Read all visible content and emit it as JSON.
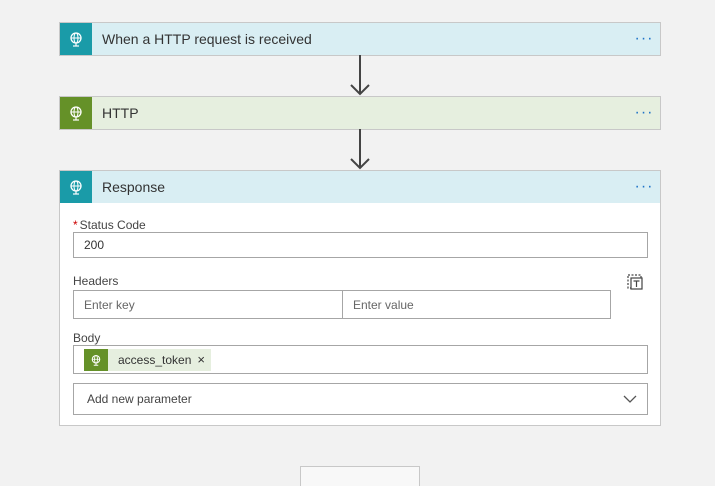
{
  "steps": {
    "trigger": {
      "title": "When a HTTP request is received",
      "more": "···",
      "icon": "globe-icon",
      "accent": "#1a9ba8"
    },
    "http": {
      "title": "HTTP",
      "more": "···",
      "icon": "globe-icon",
      "accent": "#659128"
    },
    "response": {
      "title": "Response",
      "more": "···",
      "icon": "globe-icon",
      "accent": "#1a9ba8"
    }
  },
  "response_form": {
    "status_required_marker": "*",
    "status_label": "Status Code",
    "status_value": "200",
    "headers_label": "Headers",
    "key_placeholder": "Enter key",
    "value_placeholder": "Enter value",
    "body_label": "Body",
    "body_token": {
      "label": "access_token",
      "remove": "×",
      "icon": "globe-icon"
    },
    "add_parameter_label": "Add new parameter"
  }
}
